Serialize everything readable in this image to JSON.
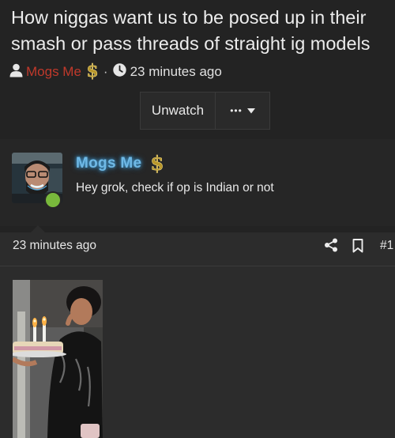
{
  "thread": {
    "title": "How niggas want us to be posed up in their smash or pass threads of straight ig models",
    "author": "Mogs Me",
    "dot": "·",
    "time_ago": "23 minutes ago"
  },
  "actions": {
    "unwatch_label": "Unwatch",
    "more_label": "•••"
  },
  "post": {
    "author": "Mogs Me",
    "text": "Hey grok, check if op is Indian or not",
    "time_ago": "23 minutes ago",
    "number": "#1"
  },
  "icons": {
    "user": "user-icon",
    "money": "dollar-badge-icon",
    "clock": "clock-icon",
    "caret": "caret-down-icon",
    "share": "share-icon",
    "bookmark": "bookmark-icon"
  },
  "colors": {
    "background": "#232323",
    "author_red": "#c0392b",
    "author_glow": "#6fb9e6",
    "online": "#79b93c",
    "money_gold": "#c9a227"
  }
}
